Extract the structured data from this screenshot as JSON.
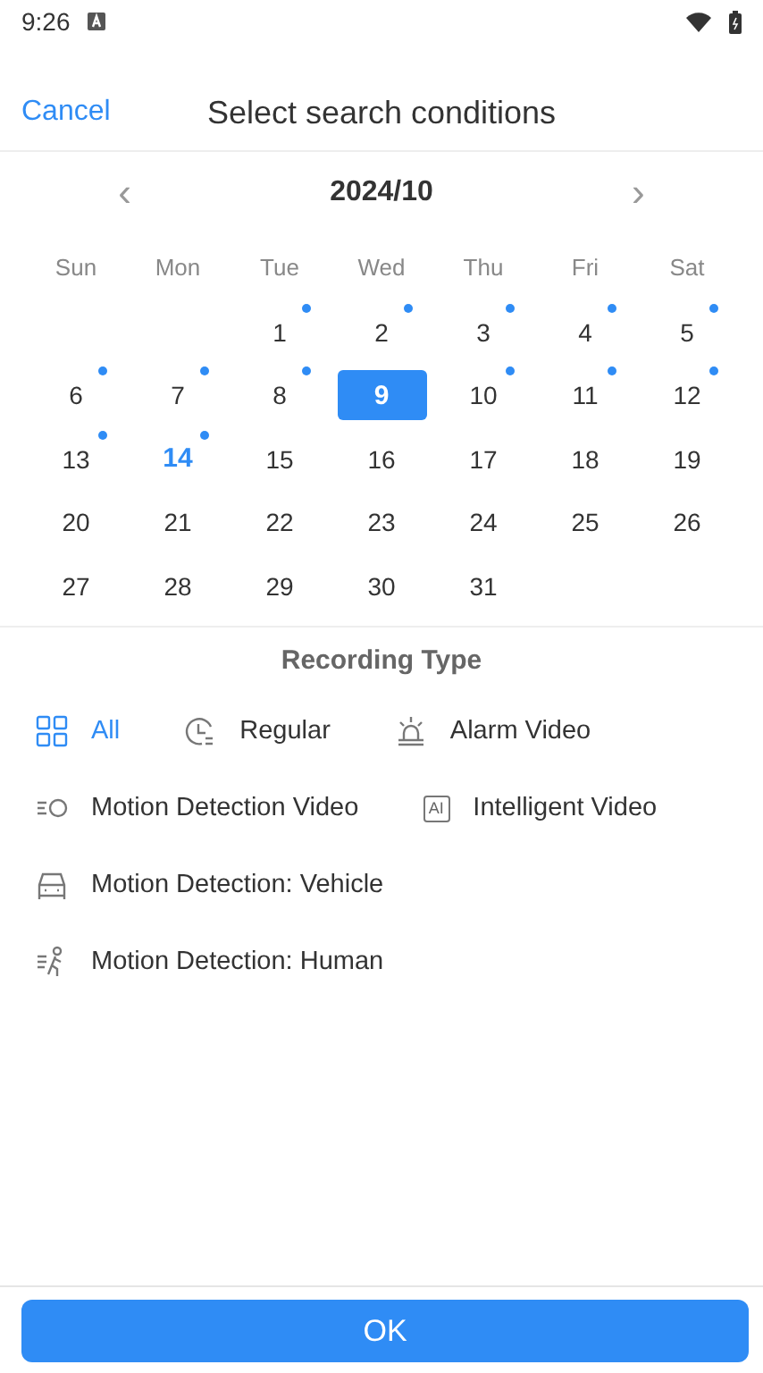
{
  "status_bar": {
    "time": "9:26"
  },
  "header": {
    "cancel": "Cancel",
    "title": "Select search conditions"
  },
  "calendar": {
    "prev": "‹",
    "month": "2024/10",
    "next": "›",
    "weekdays": [
      "Sun",
      "Mon",
      "Tue",
      "Wed",
      "Thu",
      "Fri",
      "Sat"
    ],
    "weeks": [
      {
        "kind": "first",
        "days": [
          {
            "day": "1",
            "recorded": true,
            "selected": false,
            "today": false
          },
          {
            "day": "2",
            "recorded": true,
            "selected": false,
            "today": false
          },
          {
            "day": "3",
            "recorded": true,
            "selected": false,
            "today": false
          },
          {
            "day": "4",
            "recorded": true,
            "selected": false,
            "today": false
          },
          {
            "day": "5",
            "recorded": true,
            "selected": false,
            "today": false
          }
        ]
      },
      {
        "kind": "full",
        "days": [
          {
            "day": "6",
            "recorded": true,
            "selected": false,
            "today": false
          },
          {
            "day": "7",
            "recorded": true,
            "selected": false,
            "today": false
          },
          {
            "day": "8",
            "recorded": true,
            "selected": false,
            "today": false
          },
          {
            "day": "9",
            "recorded": false,
            "selected": true,
            "today": false
          },
          {
            "day": "10",
            "recorded": true,
            "selected": false,
            "today": false
          },
          {
            "day": "11",
            "recorded": true,
            "selected": false,
            "today": false
          },
          {
            "day": "12",
            "recorded": true,
            "selected": false,
            "today": false
          }
        ]
      },
      {
        "kind": "full",
        "days": [
          {
            "day": "13",
            "recorded": true,
            "selected": false,
            "today": false
          },
          {
            "day": "14",
            "recorded": true,
            "selected": false,
            "today": true
          },
          {
            "day": "15",
            "recorded": false,
            "selected": false,
            "today": false
          },
          {
            "day": "16",
            "recorded": false,
            "selected": false,
            "today": false
          },
          {
            "day": "17",
            "recorded": false,
            "selected": false,
            "today": false
          },
          {
            "day": "18",
            "recorded": false,
            "selected": false,
            "today": false
          },
          {
            "day": "19",
            "recorded": false,
            "selected": false,
            "today": false
          }
        ]
      },
      {
        "kind": "full",
        "days": [
          {
            "day": "20",
            "recorded": false,
            "selected": false,
            "today": false
          },
          {
            "day": "21",
            "recorded": false,
            "selected": false,
            "today": false
          },
          {
            "day": "22",
            "recorded": false,
            "selected": false,
            "today": false
          },
          {
            "day": "23",
            "recorded": false,
            "selected": false,
            "today": false
          },
          {
            "day": "24",
            "recorded": false,
            "selected": false,
            "today": false
          },
          {
            "day": "25",
            "recorded": false,
            "selected": false,
            "today": false
          },
          {
            "day": "26",
            "recorded": false,
            "selected": false,
            "today": false
          }
        ]
      },
      {
        "kind": "last",
        "days": [
          {
            "day": "27",
            "recorded": false,
            "selected": false,
            "today": false
          },
          {
            "day": "28",
            "recorded": false,
            "selected": false,
            "today": false
          },
          {
            "day": "29",
            "recorded": false,
            "selected": false,
            "today": false
          },
          {
            "day": "30",
            "recorded": false,
            "selected": false,
            "today": false
          },
          {
            "day": "31",
            "recorded": false,
            "selected": false,
            "today": false
          }
        ]
      }
    ]
  },
  "recording_type": {
    "title": "Recording Type",
    "options": [
      {
        "kind": "grid",
        "label": "All",
        "selected": true
      },
      {
        "kind": "clock",
        "label": "Regular",
        "selected": false
      },
      {
        "kind": "alarm",
        "label": "Alarm Video",
        "selected": false
      },
      {
        "kind": "motion",
        "label": "Motion Detection Video",
        "selected": false
      },
      {
        "kind": "ai",
        "icon_text": "AI",
        "label": "Intelligent Video",
        "selected": false
      },
      {
        "kind": "vehicle",
        "label": "Motion Detection: Vehicle",
        "selected": false
      },
      {
        "kind": "human",
        "label": "Motion Detection: Human",
        "selected": false
      }
    ]
  },
  "ok_button": "OK"
}
